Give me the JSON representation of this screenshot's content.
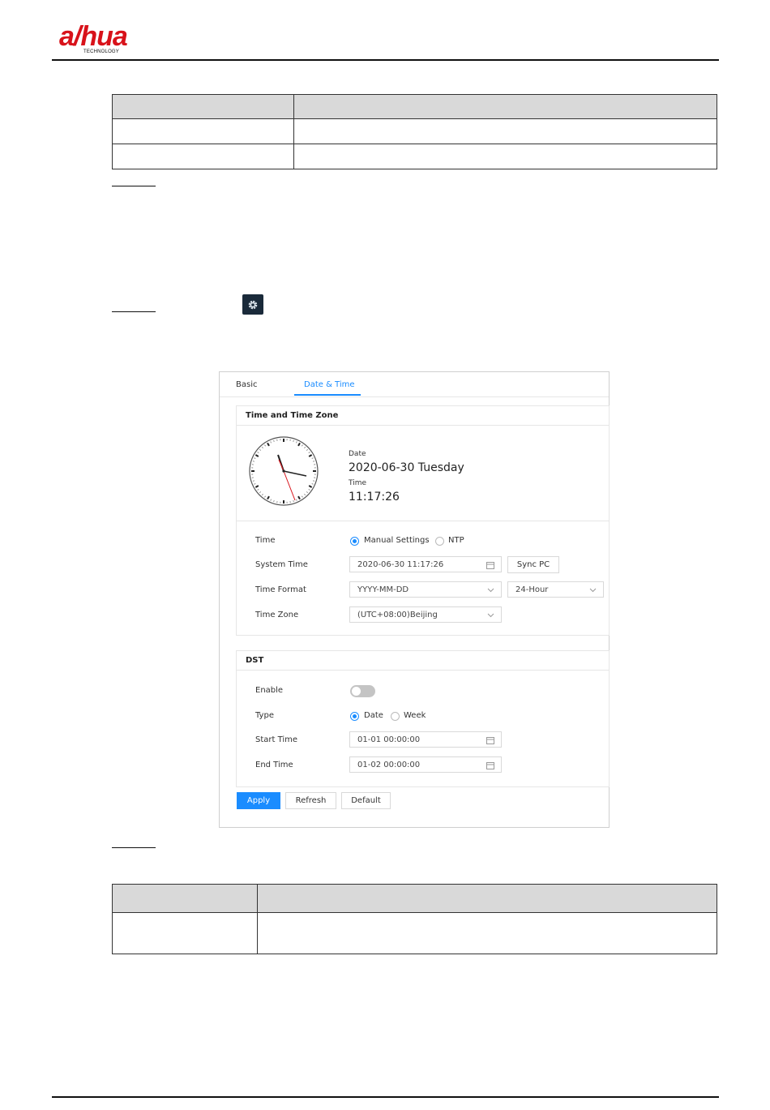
{
  "brand": {
    "logo_text": "a/hua",
    "logo_sub": "TECHNOLOGY",
    "color": "#d8121a"
  },
  "ui": {
    "tabs": [
      {
        "label": "Basic"
      },
      {
        "label": "Date & Time",
        "active": true
      }
    ],
    "time_section": {
      "title": "Time and Time Zone",
      "date_label": "Date",
      "date_value": "2020-06-30 Tuesday",
      "time_label": "Time",
      "time_value": "11:17:26",
      "time_row": {
        "label": "Time",
        "options": [
          "Manual Settings",
          "NTP"
        ],
        "selected": "Manual Settings"
      },
      "system_time": {
        "label": "System Time",
        "value": "2020-06-30 11:17:26",
        "sync_label": "Sync PC"
      },
      "time_format": {
        "label": "Time Format",
        "date_format": "YYYY-MM-DD",
        "hour_format": "24-Hour"
      },
      "time_zone": {
        "label": "Time Zone",
        "value": "(UTC+08:00)Beijing"
      }
    },
    "dst_section": {
      "title": "DST",
      "enable": {
        "label": "Enable",
        "on": false
      },
      "type": {
        "label": "Type",
        "options": [
          "Date",
          "Week"
        ],
        "selected": "Date"
      },
      "start_time": {
        "label": "Start Time",
        "value": "01-01 00:00:00"
      },
      "end_time": {
        "label": "End Time",
        "value": "01-02 00:00:00"
      }
    },
    "buttons": {
      "apply": "Apply",
      "refresh": "Refresh",
      "default": "Default"
    },
    "accent_color": "#1a8cff"
  }
}
